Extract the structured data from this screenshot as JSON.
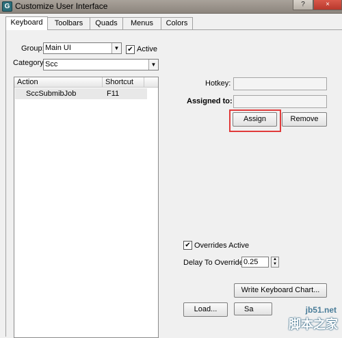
{
  "window": {
    "title": "Customize User Interface",
    "help_label": "?",
    "close_label": "×"
  },
  "tabs": [
    "Keyboard",
    "Toolbars",
    "Quads",
    "Menus",
    "Colors"
  ],
  "active_tab": "Keyboard",
  "group": {
    "label": "Group:",
    "value": "Main UI"
  },
  "active_checkbox": {
    "label": "Active",
    "checked": true
  },
  "category": {
    "label": "Category:",
    "value": "Scc"
  },
  "action_list": {
    "columns": [
      "Action",
      "Shortcut"
    ],
    "rows": [
      {
        "action": "SccSubmibJob",
        "shortcut": "F11"
      }
    ]
  },
  "hotkey": {
    "label": "Hotkey:",
    "value": ""
  },
  "assigned_to": {
    "label": "Assigned to:",
    "value": ""
  },
  "buttons": {
    "assign": "Assign",
    "remove": "Remove",
    "write_chart": "Write Keyboard Chart...",
    "load": "Load...",
    "save": "Sa"
  },
  "overrides_active": {
    "label": "Overrides Active",
    "checked": true
  },
  "delay_override": {
    "label": "Delay To Override:",
    "value": "0.25"
  },
  "watermark": {
    "site": "jb51.net",
    "logo": "脚本之家"
  }
}
